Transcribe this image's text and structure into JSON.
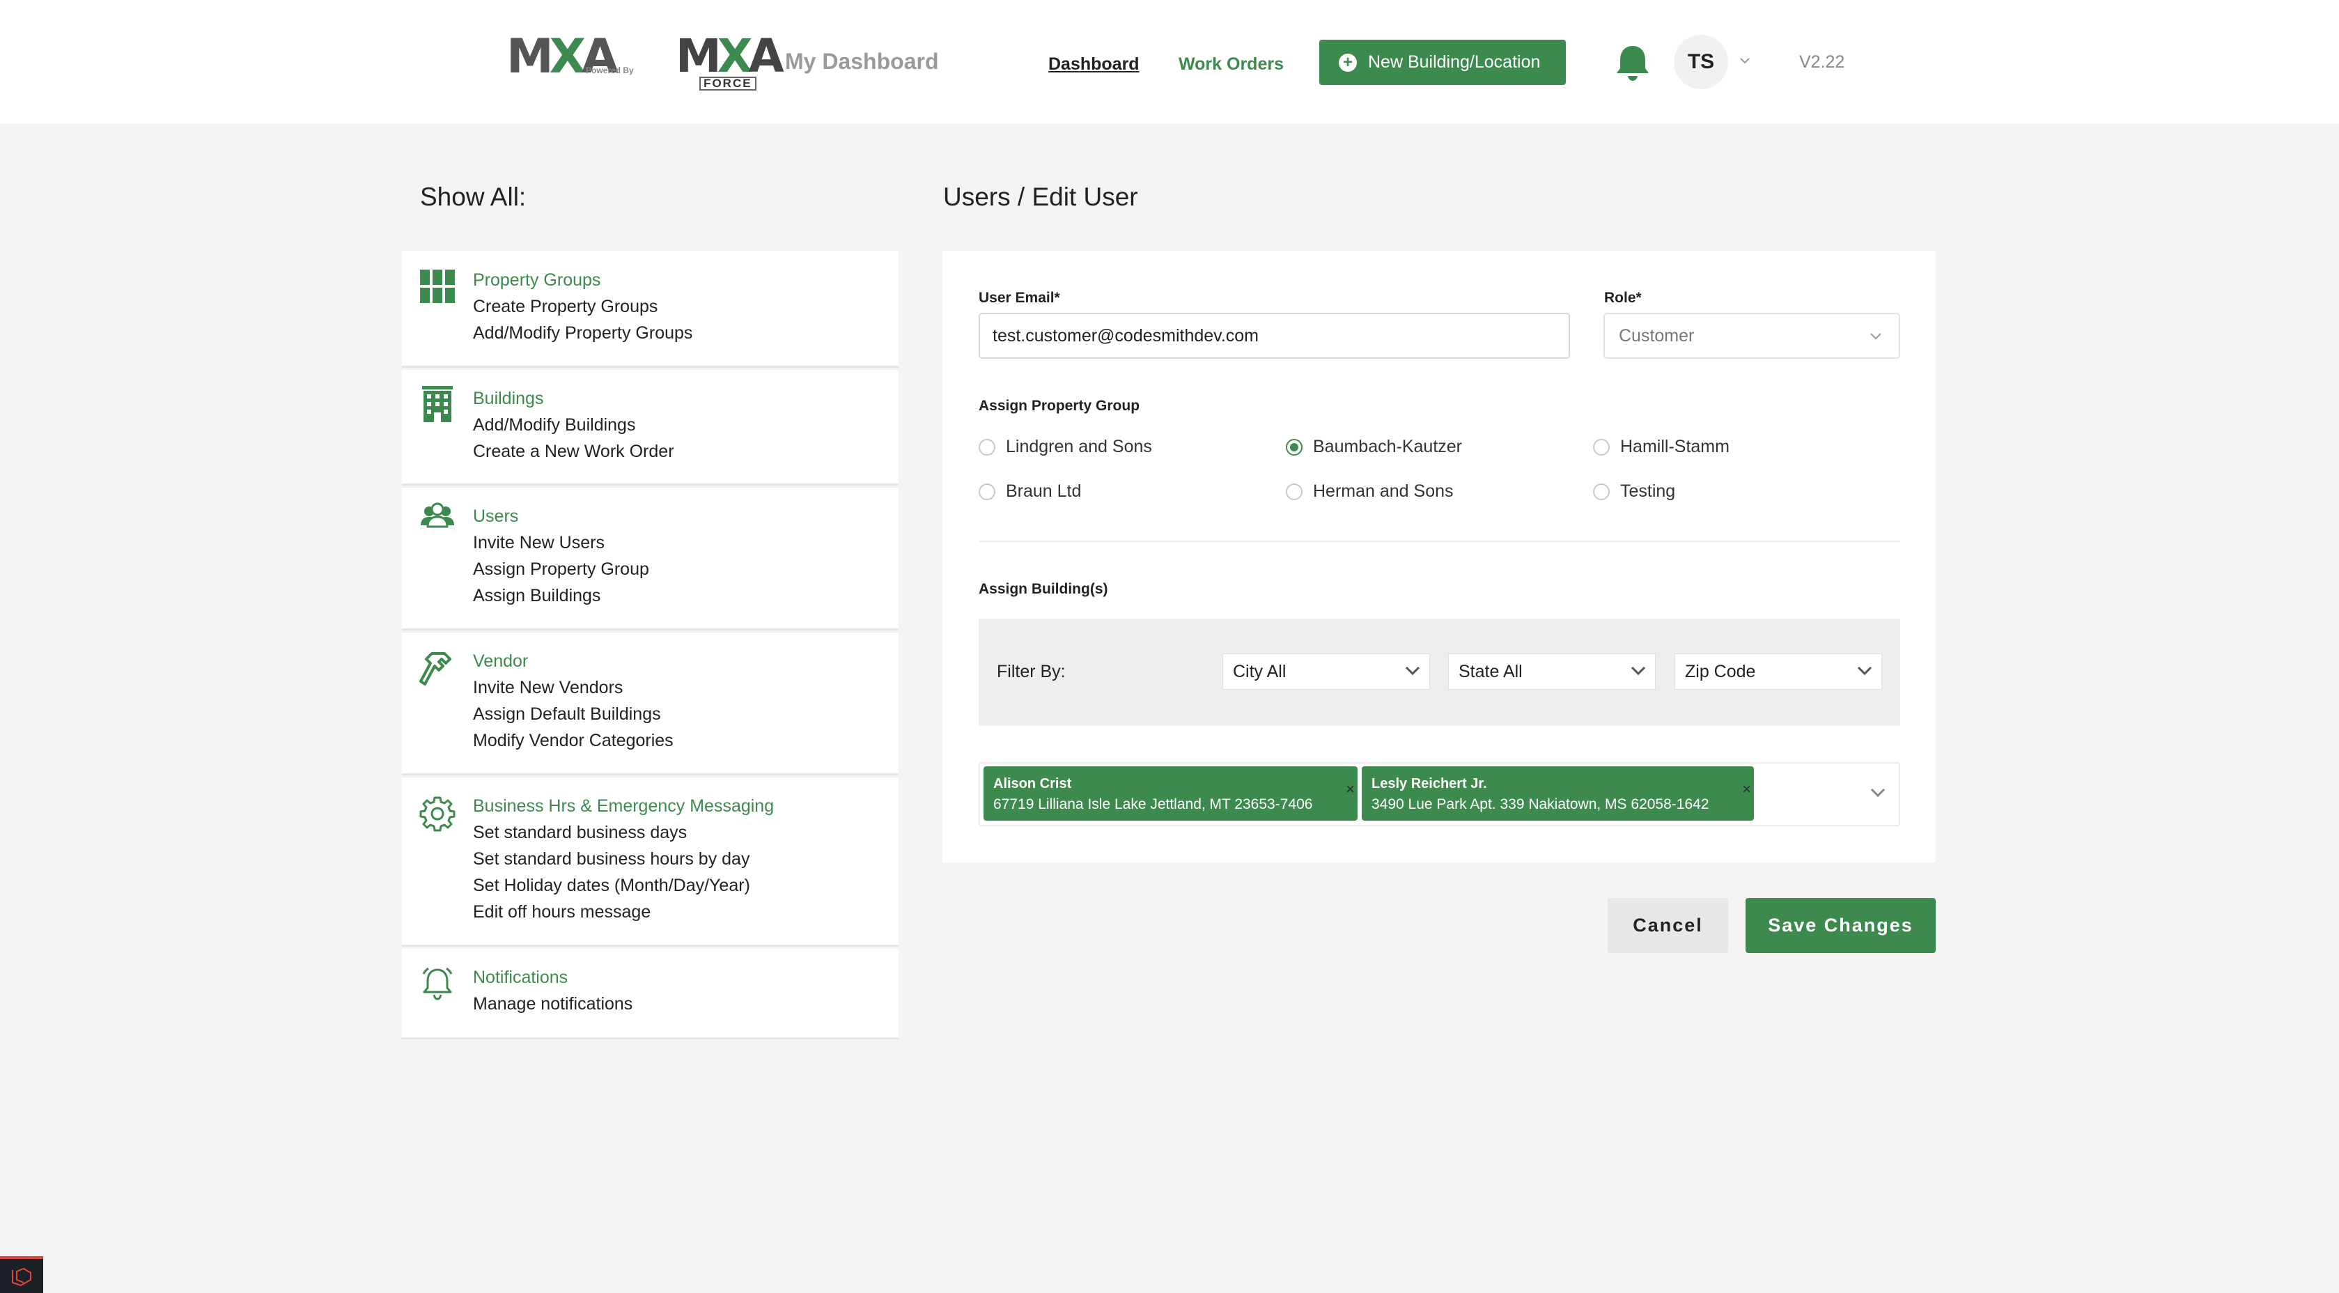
{
  "header": {
    "logo1": {
      "m": "M",
      "x": "X",
      "a": "A",
      "tag": "Powered By"
    },
    "logo2": {
      "m": "M",
      "x": "X",
      "a": "A",
      "tag": "FORCE"
    },
    "app_title": "My Dashboard",
    "nav": {
      "dashboard": "Dashboard",
      "work_orders": "Work Orders"
    },
    "new_button": "New Building/Location",
    "new_button_icon": "plus-circle-icon",
    "avatar_initials": "TS",
    "version": "V2.22"
  },
  "sidebar": {
    "heading": "Show All:",
    "sections": [
      {
        "icon": "grid-icon",
        "title": "Property Groups",
        "links": [
          "Create Property Groups",
          "Add/Modify Property Groups"
        ]
      },
      {
        "icon": "building-icon",
        "title": "Buildings",
        "links": [
          "Add/Modify Buildings",
          "Create a New Work Order"
        ]
      },
      {
        "icon": "users-icon",
        "title": "Users",
        "links": [
          "Invite New Users",
          "Assign Property Group",
          "Assign Buildings"
        ]
      },
      {
        "icon": "hammer-icon",
        "title": "Vendor",
        "links": [
          "Invite New Vendors",
          "Assign Default Buildings",
          "Modify Vendor Categories"
        ]
      },
      {
        "icon": "gear-icon",
        "title": "Business Hrs & Emergency Messaging",
        "links": [
          "Set standard business days",
          "Set standard business hours by day",
          "Set Holiday dates (Month/Day/Year)",
          "Edit off hours message"
        ]
      },
      {
        "icon": "bell-icon",
        "title": "Notifications",
        "links": [
          "Manage notifications"
        ]
      }
    ]
  },
  "main": {
    "breadcrumb": "Users / Edit User",
    "email_label": "User Email*",
    "email_value": "test.customer@codesmithdev.com",
    "role_label": "Role*",
    "role_value": "Customer",
    "property_group_label": "Assign Property Group",
    "property_groups": [
      {
        "label": "Lindgren and Sons",
        "selected": false
      },
      {
        "label": "Baumbach-Kautzer",
        "selected": true
      },
      {
        "label": "Hamill-Stamm",
        "selected": false
      },
      {
        "label": "Braun Ltd",
        "selected": false
      },
      {
        "label": "Herman and Sons",
        "selected": false
      },
      {
        "label": "Testing",
        "selected": false
      }
    ],
    "buildings_label": "Assign Building(s)",
    "filter": {
      "label": "Filter By:",
      "city": "City All",
      "state": "State All",
      "zip": "Zip Code"
    },
    "selected_buildings": [
      {
        "name": "Alison Crist",
        "address": "67719 Lilliana Isle Lake Jettland, MT 23653-7406",
        "remove": "×"
      },
      {
        "name": "Lesly Reichert Jr.",
        "address": "3490 Lue Park Apt. 339 Nakiatown, MS 62058-1642",
        "remove": "×"
      }
    ],
    "cancel": "Cancel",
    "save": "Save Changes"
  },
  "colors": {
    "brand_green": "#3c8a4e",
    "page_bg": "#f4f4f4"
  }
}
